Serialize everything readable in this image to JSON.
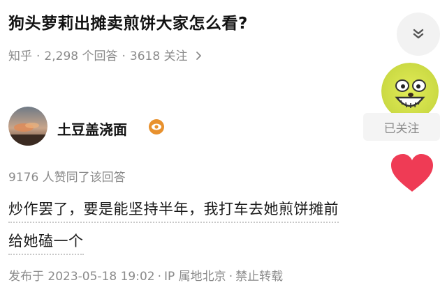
{
  "question": {
    "title": "狗头萝莉出摊卖煎饼大家怎么看?",
    "source": "知乎",
    "answer_count": "2,298 个回答",
    "follower_count": "3618 关注",
    "separator": "·"
  },
  "author": {
    "name": "土豆盖浇面",
    "follow_label": "已关注"
  },
  "answer": {
    "vote_summary": "9176 人赞同了该回答",
    "lines": [
      "炒作罢了，要是能坚持半年，我打车去她煎饼摊前",
      "给她磕一个"
    ],
    "published": "发布于 2023-05-18 19:02",
    "ip_location": "IP 属地北京",
    "rights": "禁止转载"
  },
  "icons": {
    "collapse": "chevron-down-icon",
    "meta_arrow": "chevron-right-icon",
    "badge": "eye-badge-icon",
    "like": "heart-icon"
  },
  "colors": {
    "heart": "#ef3b55",
    "badge": "#e8912e",
    "muted_text": "#8a8a8a"
  }
}
